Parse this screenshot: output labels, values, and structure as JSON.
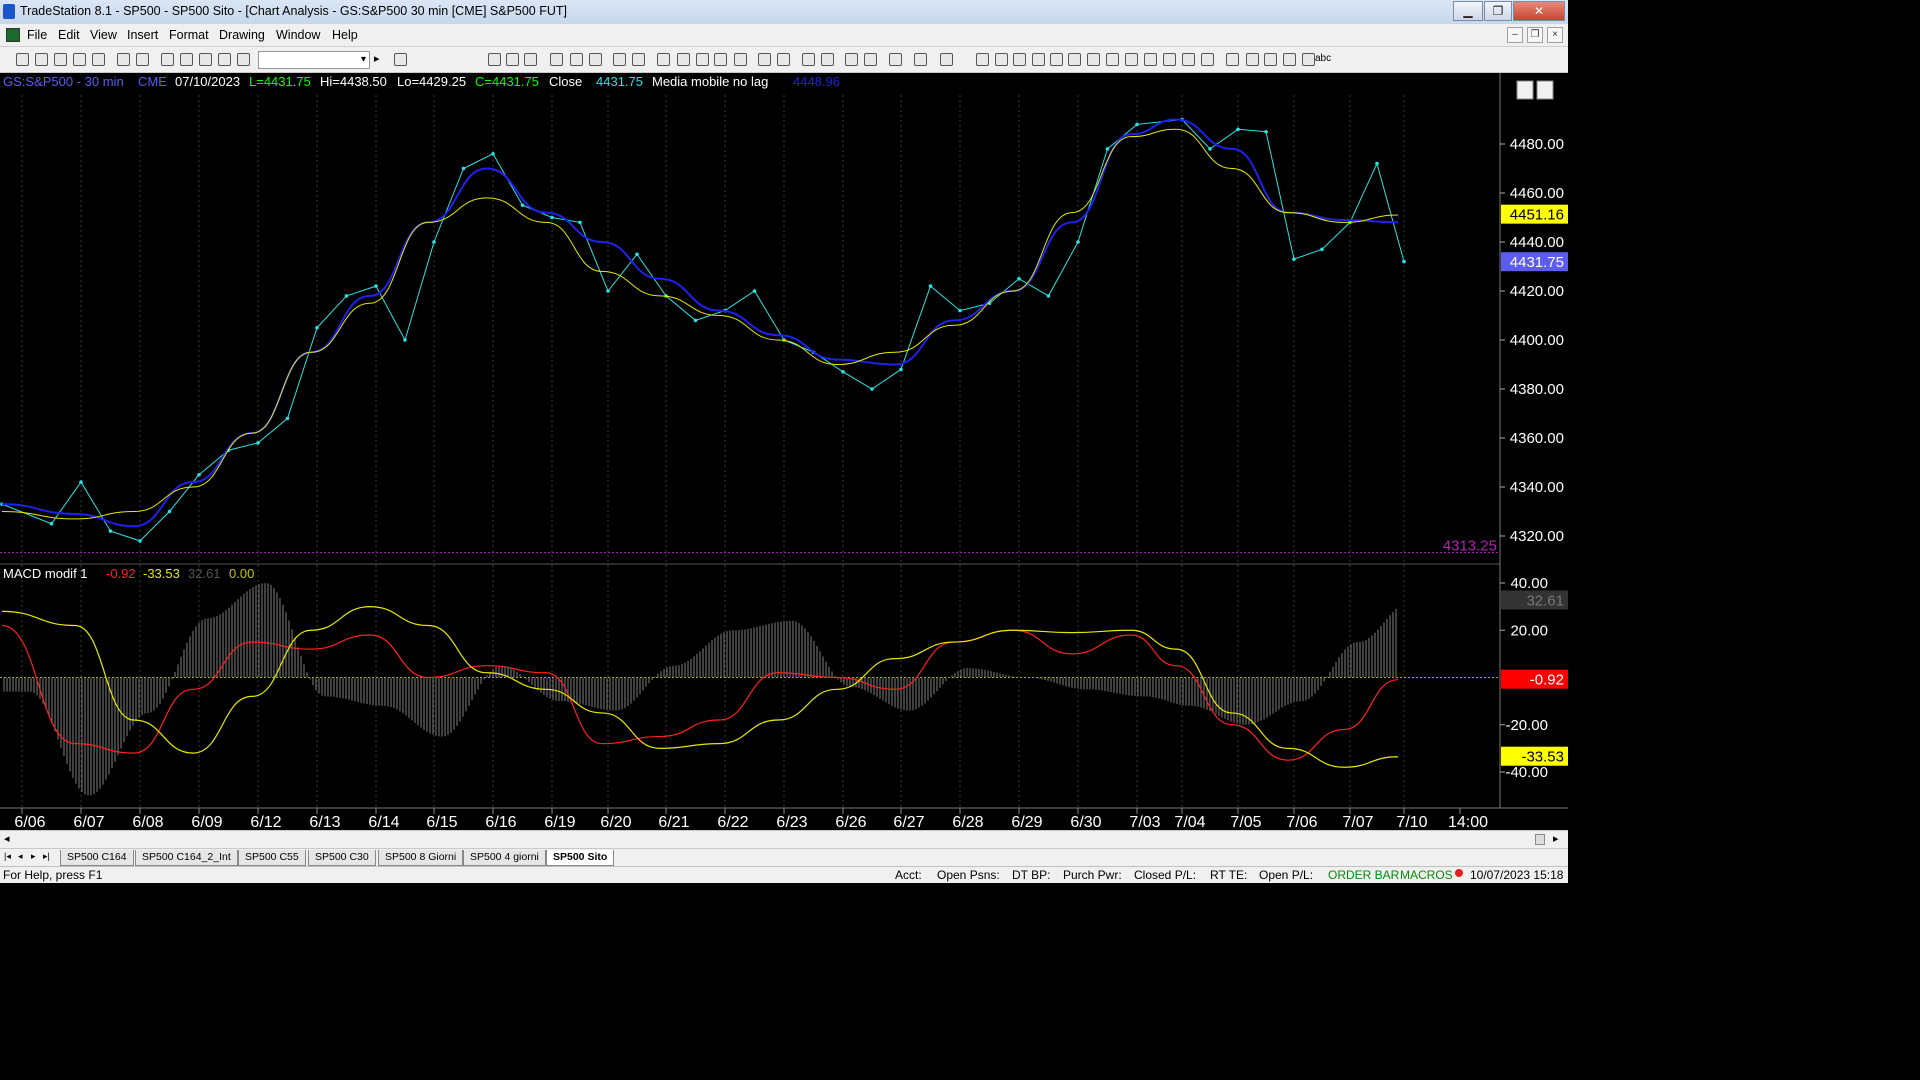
{
  "window": {
    "title": "TradeStation 8.1 - SP500 - SP500 Sito - [Chart Analysis - GS:S&P500  30 min  [CME] S&P500 FUT]",
    "min": "▁",
    "max": "❐",
    "close": "✕"
  },
  "menu": [
    "File",
    "Edit",
    "View",
    "Insert",
    "Format",
    "Drawing",
    "Window",
    "Help"
  ],
  "mdi": {
    "min": "–",
    "restore": "❐",
    "close": "×"
  },
  "toolbar": {
    "combo_value": "",
    "combo_arrow": "▾",
    "next_arrow": "▸",
    "text_tool": "abc"
  },
  "header": {
    "symbol": "GS:S&P500 - 30 min",
    "exchange": "CME",
    "date": "07/10/2023",
    "last": "L=4431.75",
    "high": "Hi=4438.50",
    "low": "Lo=4429.25",
    "close_val": "C=4431.75",
    "close_label": "Close",
    "close_price": "4431.75",
    "ma_label": "Media mobile no lag",
    "ma_value": "4448.96"
  },
  "macd_header": {
    "name": "MACD modif 1",
    "v1": "-0.92",
    "v2": "-33.53",
    "v3": "32.61",
    "v4": "0.00"
  },
  "chart_data": [
    {
      "type": "line",
      "title": "GS:S&P500 - 30 min",
      "y_ticks": [
        "4480.00",
        "4460.00",
        "4440.00",
        "4420.00",
        "4400.00",
        "4380.00",
        "4360.00",
        "4340.00",
        "4320.00"
      ],
      "ylim": [
        4312,
        4496
      ],
      "x_ticks": [
        "6/06",
        "6/07",
        "6/08",
        "6/09",
        "6/12",
        "6/13",
        "6/14",
        "6/15",
        "6/16",
        "6/19",
        "6/20",
        "6/21",
        "6/22",
        "6/23",
        "6/26",
        "6/27",
        "6/28",
        "6/29",
        "6/30",
        "7/03",
        "7/04",
        "7/05",
        "7/06",
        "7/07",
        "7/10",
        "14:00"
      ],
      "price_labels": [
        {
          "text": "4451.16",
          "value": 4451.16,
          "color": "#ffff00"
        },
        {
          "text": "4431.75",
          "value": 4431.75,
          "color": "#5c5cf0"
        },
        {
          "text": "4313.25",
          "value": 4313.25,
          "color": "#b020b0"
        }
      ],
      "series": [
        {
          "name": "Close",
          "color": "#29e3e3",
          "x": [
            "6/06",
            "6/06 mid",
            "6/07",
            "6/07 mid",
            "6/08",
            "6/08 mid",
            "6/09",
            "6/09 mid",
            "6/12",
            "6/12 mid",
            "6/13",
            "6/13 mid",
            "6/14",
            "6/14 mid",
            "6/15",
            "6/15 mid",
            "6/16",
            "6/16 mid",
            "6/19",
            "6/19 mid",
            "6/20",
            "6/20 mid",
            "6/21",
            "6/21 mid",
            "6/22",
            "6/22 mid",
            "6/23",
            "6/23 mid",
            "6/26",
            "6/26 mid",
            "6/27",
            "6/27 mid",
            "6/28",
            "6/28 mid",
            "6/29",
            "6/29 mid",
            "6/30",
            "6/30 mid",
            "7/03",
            "7/04",
            "7/04 mid",
            "7/05",
            "7/05 mid",
            "7/06",
            "7/06 mid",
            "7/07",
            "7/07 mid",
            "7/10"
          ],
          "values": [
            4333,
            4325,
            4342,
            4322,
            4318,
            4330,
            4345,
            4355,
            4358,
            4368,
            4405,
            4418,
            4422,
            4400,
            4440,
            4470,
            4476,
            4455,
            4450,
            4448,
            4420,
            4435,
            4418,
            4408,
            4412,
            4420,
            4400,
            4395,
            4387,
            4380,
            4388,
            4422,
            4412,
            4415,
            4425,
            4418,
            4440,
            4478,
            4488,
            4490,
            4478,
            4486,
            4485,
            4433,
            4437,
            4448,
            4472,
            4432
          ]
        },
        {
          "name": "Media mobile no lag",
          "color": "#2020f0",
          "x": [
            "6/06",
            "6/07",
            "6/08",
            "6/09",
            "6/12",
            "6/13",
            "6/14",
            "6/15",
            "6/16",
            "6/19",
            "6/20",
            "6/21",
            "6/22",
            "6/23",
            "6/26",
            "6/27",
            "6/28",
            "6/29",
            "6/30",
            "7/03",
            "7/04",
            "7/05",
            "7/06",
            "7/07",
            "7/10"
          ],
          "values": [
            4333,
            4329,
            4324,
            4342,
            4362,
            4395,
            4418,
            4448,
            4470,
            4452,
            4440,
            4425,
            4412,
            4402,
            4392,
            4390,
            4408,
            4420,
            4448,
            4484,
            4490,
            4478,
            4452,
            4449,
            4448
          ]
        },
        {
          "name": "",
          "color": "#e8e800",
          "x": [
            "6/06",
            "6/07",
            "6/08",
            "6/09",
            "6/12",
            "6/13",
            "6/14",
            "6/15",
            "6/16",
            "6/19",
            "6/20",
            "6/21",
            "6/22",
            "6/23",
            "6/26",
            "6/27",
            "6/28",
            "6/29",
            "6/30",
            "7/03",
            "7/04",
            "7/05",
            "7/06",
            "7/07",
            "7/10"
          ],
          "values": [
            4330,
            4327,
            4330,
            4340,
            4362,
            4395,
            4415,
            4448,
            4458,
            4448,
            4428,
            4418,
            4410,
            4400,
            4390,
            4395,
            4406,
            4420,
            4452,
            4483,
            4486,
            4470,
            4452,
            4448,
            4451
          ]
        }
      ]
    },
    {
      "type": "line",
      "title": "MACD modif 1",
      "y_ticks": [
        "40.00",
        "20.00",
        "-20.00",
        "-40.00"
      ],
      "ylim": [
        -52,
        43
      ],
      "price_labels": [
        {
          "text": "32.61",
          "value": 32.61,
          "color": "#555555"
        },
        {
          "text": "-0.92",
          "value": -0.92,
          "color": "#ff0000"
        },
        {
          "text": "-33.53",
          "value": -33.53,
          "color": "#ffff00"
        }
      ],
      "series": [
        {
          "name": "",
          "color": "#ff2020",
          "x": [
            "6/06",
            "6/07",
            "6/08",
            "6/09",
            "6/12",
            "6/13",
            "6/14",
            "6/15",
            "6/16",
            "6/19",
            "6/20",
            "6/21",
            "6/22",
            "6/23",
            "6/26",
            "6/27",
            "6/28",
            "6/29",
            "6/30",
            "7/03",
            "7/04",
            "7/05",
            "7/06",
            "7/07",
            "7/10"
          ],
          "values": [
            22,
            -28,
            -32,
            -5,
            15,
            12,
            18,
            0,
            5,
            2,
            -28,
            -25,
            -18,
            2,
            0,
            -5,
            15,
            20,
            10,
            18,
            5,
            -20,
            -35,
            -22,
            -0.92
          ]
        },
        {
          "name": "",
          "color": "#e8e800",
          "x": [
            "6/06",
            "6/07",
            "6/08",
            "6/09",
            "6/12",
            "6/13",
            "6/14",
            "6/15",
            "6/16",
            "6/19",
            "6/20",
            "6/21",
            "6/22",
            "6/23",
            "6/26",
            "6/27",
            "6/28",
            "6/29",
            "6/30",
            "7/03",
            "7/04",
            "7/05",
            "7/06",
            "7/07",
            "7/10"
          ],
          "values": [
            28,
            22,
            -18,
            -32,
            -8,
            20,
            30,
            22,
            2,
            -5,
            -15,
            -30,
            -28,
            -18,
            -5,
            8,
            15,
            20,
            19,
            20,
            12,
            -15,
            -30,
            -38,
            -33.53
          ]
        },
        {
          "name": "",
          "color": "#808080",
          "type": "histogram",
          "x": [
            "6/06",
            "6/07",
            "6/08",
            "6/09",
            "6/12",
            "6/13",
            "6/14",
            "6/15",
            "6/16",
            "6/19",
            "6/20",
            "6/21",
            "6/22",
            "6/23",
            "6/26",
            "6/27",
            "6/28",
            "6/29",
            "6/30",
            "7/03",
            "7/04",
            "7/05",
            "7/06",
            "7/07",
            "7/10"
          ],
          "values": [
            -6,
            -50,
            -15,
            25,
            40,
            -8,
            -12,
            -25,
            5,
            -10,
            -14,
            5,
            20,
            24,
            -4,
            -14,
            4,
            0,
            -5,
            -8,
            -12,
            -20,
            -10,
            15,
            32.61
          ]
        }
      ]
    }
  ],
  "tabs": [
    "SP500 C164",
    "SP500 C164_2_Int",
    "SP500 C55",
    "SP500 C30",
    "SP500 8 Giorni",
    "SP500 4 giorni",
    "SP500 Sito"
  ],
  "tab_nav": [
    "|◂",
    "◂",
    "▸",
    "▸|"
  ],
  "status": {
    "help": "For Help, press F1",
    "acct": "Acct:",
    "open_psns": "Open Psns:",
    "dt_bp": "DT BP:",
    "purch_pwr": "Purch Pwr:",
    "closed_pl": "Closed P/L:",
    "rt_te": "RT TE:",
    "open_pl": "Open P/L:",
    "order_bar": "ORDER BAR",
    "macros": "MACROS",
    "datetime": "10/07/2023 15:18"
  },
  "colors": {
    "bg": "#000000",
    "price": "#29e3e3",
    "ma_blue": "#2020f0",
    "ma_yellow": "#e8e800",
    "green": "#00ff00"
  }
}
